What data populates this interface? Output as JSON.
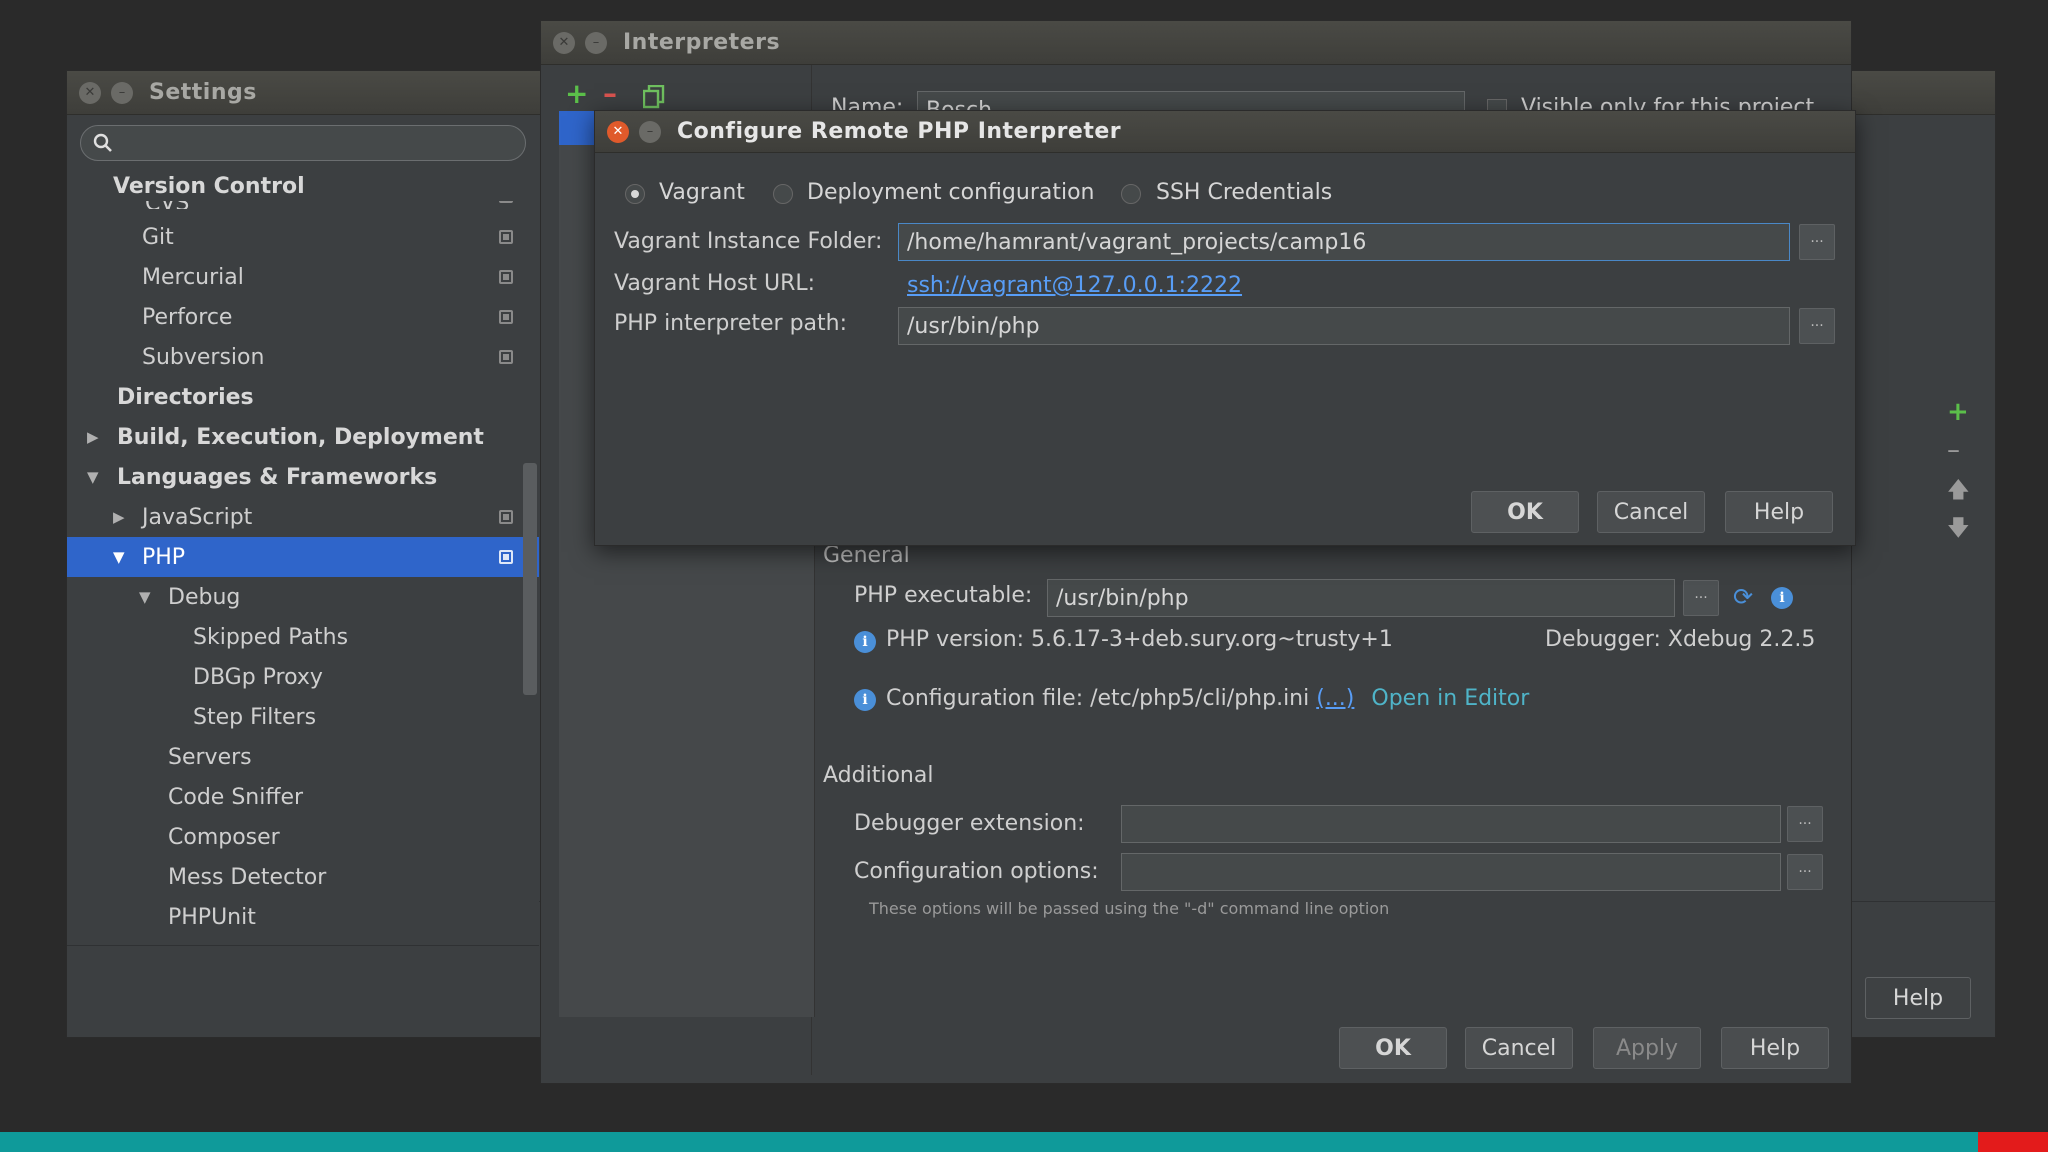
{
  "settings": {
    "title": "Settings",
    "search_placeholder": "",
    "tree": {
      "version_control": "Version Control",
      "cvs": "CVS",
      "git": "Git",
      "mercurial": "Mercurial",
      "perforce": "Perforce",
      "subversion": "Subversion",
      "directories": "Directories",
      "build": "Build, Execution, Deployment",
      "languages": "Languages & Frameworks",
      "javascript": "JavaScript",
      "php": "PHP",
      "debug": "Debug",
      "skipped_paths": "Skipped Paths",
      "dbgp_proxy": "DBGp Proxy",
      "step_filters": "Step Filters",
      "servers": "Servers",
      "code_sniffer": "Code Sniffer",
      "composer": "Composer",
      "mess_detector": "Mess Detector",
      "phpunit": "PHPUnit"
    },
    "help_label": "Help"
  },
  "interpreters": {
    "title": "Interpreters",
    "name_label": "Name:",
    "name_value": "Bosch",
    "visible_only_label": "Visible only for this project",
    "general_label": "General",
    "php_executable_label": "PHP executable:",
    "php_executable_value": "/usr/bin/php",
    "php_version": "PHP version: 5.6.17-3+deb.sury.org~trusty+1",
    "debugger": "Debugger: Xdebug 2.2.5",
    "config_file": "Configuration file: /etc/php5/cli/php.ini",
    "config_file_link": "(...)",
    "open_in_editor": "Open in Editor",
    "additional_label": "Additional",
    "debugger_extension_label": "Debugger extension:",
    "configuration_options_label": "Configuration options:",
    "options_hint": "These options will be passed using the \"-d\" command line option",
    "ok": "OK",
    "cancel": "Cancel",
    "apply": "Apply",
    "help": "Help"
  },
  "remote_dialog": {
    "title": "Configure Remote PHP Interpreter",
    "radio_vagrant": "Vagrant",
    "radio_deployment": "Deployment configuration",
    "radio_ssh": "SSH Credentials",
    "instance_folder_label": "Vagrant Instance Folder:",
    "instance_folder_value": "/home/hamrant/vagrant_projects/camp16",
    "host_url_label": "Vagrant Host URL:",
    "host_url_value": "ssh://vagrant@127.0.0.1:2222",
    "interpreter_path_label": "PHP interpreter path:",
    "interpreter_path_value": "/usr/bin/php",
    "ok": "OK",
    "cancel": "Cancel",
    "help": "Help"
  }
}
